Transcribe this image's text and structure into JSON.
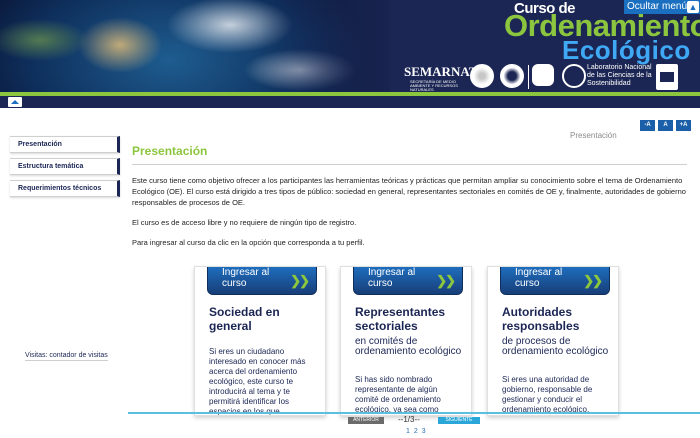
{
  "header": {
    "title_line1": "Curso de",
    "title_line2": "Ordenamiento",
    "title_line3": "Ecológico",
    "hide_menu": "Ocultar menú",
    "semarnat": "SEMARNAT",
    "semarnat_sub": "SECRETARÍA DE MEDIO AMBIENTE Y RECURSOS NATURALES",
    "lab": "Laboratorio Nacional de las Ciencias de la Sostenibilidad"
  },
  "sidebar": {
    "items": [
      {
        "label": "Presentación"
      },
      {
        "label": "Estructura temática"
      },
      {
        "label": "Requerimientos técnicos"
      }
    ],
    "visits": "Visitas: contador de visitas"
  },
  "font_tools": [
    "-A",
    "A",
    "+A"
  ],
  "breadcrumb": "Presentación",
  "main": {
    "title": "Presentación",
    "p1": "Este curso tiene como objetivo ofrecer a los participantes las herramientas teóricas y prácticas que permitan ampliar su conocimiento sobre el tema de Ordenamiento Ecológico (OE). El curso está dirigido a tres tipos de público: sociedad en general, representantes sectoriales en comités de OE y, finalmente, autoridades de gobierno responsables de procesos de OE.",
    "p2": "El curso es de acceso libre y no requiere de ningún tipo de registro.",
    "p3": "Para ingresar al curso da clic en la opción que corresponda a tu perfil."
  },
  "cards": [
    {
      "btn": "Ingresar al curso",
      "title": "Sociedad en general",
      "subtitle": "",
      "body": "Si eres un ciudadano interesado en conocer más acerca del ordenamiento ecológico, este curso te introducirá al tema y te permitirá identificar los espacios en los que"
    },
    {
      "btn": "Ingresar al curso",
      "title": "Representantes sectoriales",
      "subtitle": "en comités de ordenamiento ecológico",
      "body": "Si has sido nombrado representante de algún comité de ordenamiento ecológico, ya sea como"
    },
    {
      "btn": "Ingresar al curso",
      "title": "Autoridades responsables",
      "subtitle": "de procesos de ordenamiento ecológico",
      "body": "Si eres una autoridad de gobierno, responsable de gestionar y conducir el ordenamiento ecológico,"
    }
  ],
  "footer": {
    "prev": "ANTERIOR",
    "page": "--1/3--",
    "next": "SIGUIENTE",
    "pages": [
      "1",
      "2",
      "3"
    ]
  },
  "colors": {
    "navy": "#1b2654",
    "green": "#8cc63f",
    "blue": "#3fa9f5",
    "accent_bar": "#5bc0de"
  }
}
